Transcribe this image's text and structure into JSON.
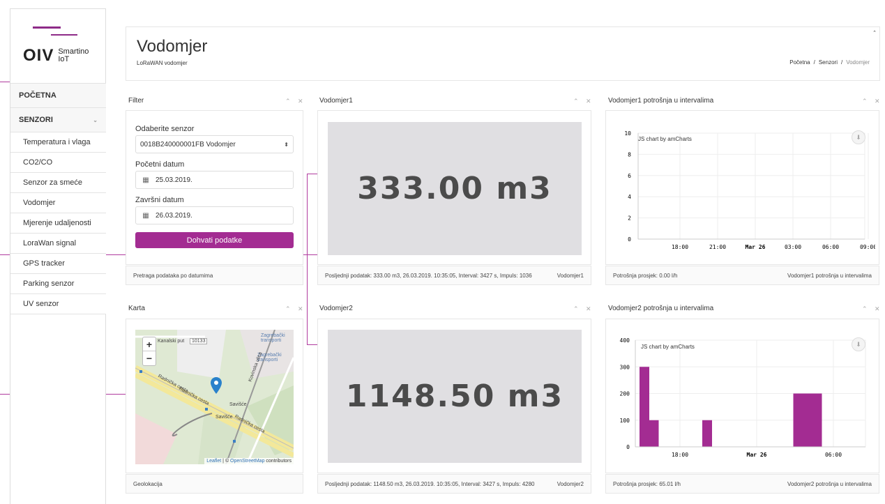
{
  "logo": {
    "main": "OIV",
    "sub_line1": "Smartino",
    "sub_line2": "IoT"
  },
  "sidebar": {
    "home": "POČETNA",
    "sensors_section": "SENZORI",
    "items": [
      {
        "label": "Temperatura i vlaga"
      },
      {
        "label": "CO2/CO"
      },
      {
        "label": "Senzor za smeće"
      },
      {
        "label": "Vodomjer"
      },
      {
        "label": "Mjerenje udaljenosti"
      },
      {
        "label": "LoraWan signal"
      },
      {
        "label": "GPS tracker"
      },
      {
        "label": "Parking senzor"
      },
      {
        "label": "UV senzor"
      }
    ]
  },
  "header": {
    "title": "Vodomjer",
    "subtitle": "LoRaWAN vodomjer",
    "breadcrumb": [
      "Početna",
      "Senzori",
      "Vodomjer"
    ],
    "collapse_icon": "⌃"
  },
  "filter": {
    "title": "Filter",
    "sensor_label": "Odaberite senzor",
    "sensor_value": "0018B240000001FB Vodomjer",
    "start_label": "Početni datum",
    "start_value": "25.03.2019.",
    "end_label": "Završni datum",
    "end_value": "26.03.2019.",
    "button": "Dohvati podatke",
    "footer": "Pretraga podataka po datumima"
  },
  "map": {
    "title": "Karta",
    "footer": "Geolokacija",
    "attribution_leaflet": "Leaflet",
    "attribution_sep": " | © ",
    "attribution_osm": "OpenStreetMap",
    "attribution_tail": " contributors",
    "labels": [
      "Kanalski put",
      "10133",
      "Zagrebački transporti",
      "Zagrebački transporti",
      "Radnička cesta",
      "Radnička cesta",
      "Savišće",
      "Savišće",
      "Radnička cesta",
      "Kovinska ulica"
    ]
  },
  "meter1": {
    "title": "Vodomjer1",
    "value": "333.00 m3",
    "footer_left": "Posljednji podatak: 333.00 m3, 26.03.2019. 10:35:05, Interval: 3427 s, Impuls: 1036",
    "footer_right": "Vodomjer1"
  },
  "meter2": {
    "title": "Vodomjer2",
    "value": "1148.50 m3",
    "footer_left": "Posljednji podatak: 1148.50 m3, 26.03.2019. 10:35:05, Interval: 3427 s, Impuls: 4280",
    "footer_right": "Vodomjer2"
  },
  "usage1": {
    "title": "Vodomjer1 potrošnja u intervalima",
    "credit": "JS chart by amCharts",
    "footer_left": "Potrošnja prosjek: 0.00 l/h",
    "footer_right": "Vodomjer1 potrošnja u intervalima"
  },
  "usage2": {
    "title": "Vodomjer2 potrošnja u intervalima",
    "credit": "JS chart by amCharts",
    "footer_left": "Potrošnja prosjek: 65.01 l/h",
    "footer_right": "Vodomjer2 potrošnja u intervalima"
  },
  "panel_tools": "⌃ ✕",
  "chart_data": [
    {
      "type": "line",
      "title": "",
      "x_ticks": [
        "18:00",
        "21:00",
        "Mar 26",
        "03:00",
        "06:00",
        "09:00"
      ],
      "y_ticks": [
        0,
        2,
        4,
        6,
        8,
        10
      ],
      "ylim": [
        0,
        10
      ],
      "series": [
        {
          "values": []
        }
      ],
      "grid": true
    },
    {
      "type": "bar",
      "title": "",
      "x_ticks": [
        "18:00",
        "Mar 26",
        "06:00"
      ],
      "y_ticks": [
        0,
        100,
        200,
        300,
        400
      ],
      "ylim": [
        0,
        400
      ],
      "color": "#a32c92",
      "bars": [
        {
          "t": 0.0,
          "value": 300
        },
        {
          "t": 0.09,
          "value": 100
        },
        {
          "t": 0.6,
          "value": 100
        },
        {
          "t": 1.47,
          "value": 200
        },
        {
          "t": 1.56,
          "value": 200
        },
        {
          "t": 1.65,
          "value": 200
        }
      ],
      "grid": true
    }
  ]
}
